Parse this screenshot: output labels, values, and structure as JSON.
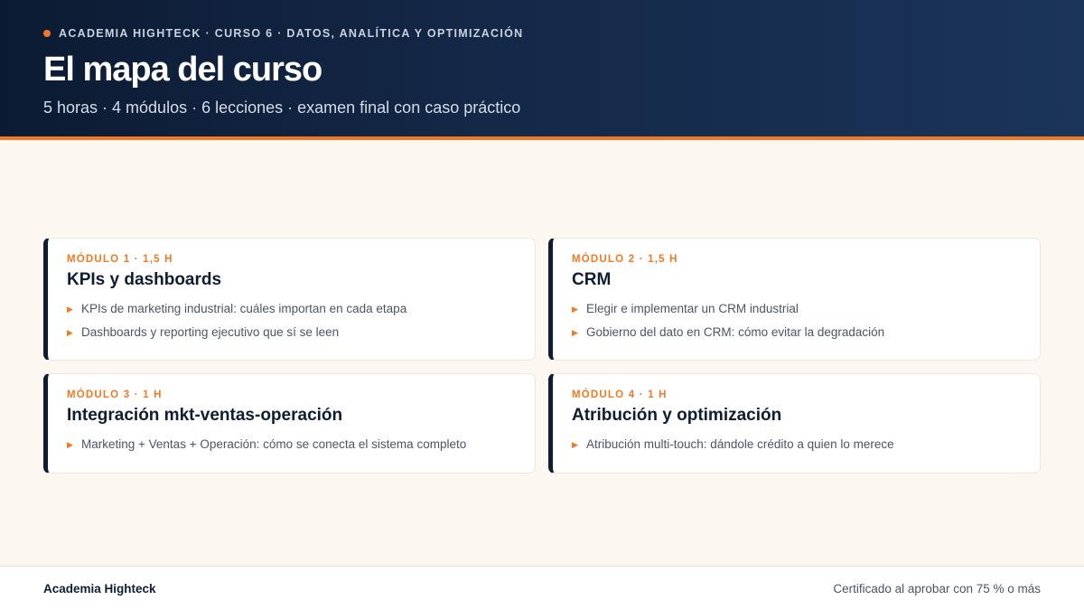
{
  "header": {
    "eyebrow": "ACADEMIA HIGHTECK · CURSO 6 · DATOS, ANALÍTICA Y OPTIMIZACIÓN",
    "title": "El mapa del curso",
    "subtitle": "5 horas · 4 módulos · 6 lecciones · examen final con caso práctico"
  },
  "modules": [
    {
      "meta": "MÓDULO 1 · 1,5 H",
      "title": "KPIs y dashboards",
      "lessons": [
        "KPIs de marketing industrial: cuáles importan en cada etapa",
        "Dashboards y reporting ejecutivo que sí se leen"
      ]
    },
    {
      "meta": "MÓDULO 2 · 1,5 H",
      "title": "CRM",
      "lessons": [
        "Elegir e implementar un CRM industrial",
        "Gobierno del dato en CRM: cómo evitar la degradación"
      ]
    },
    {
      "meta": "MÓDULO 3 · 1 H",
      "title": "Integración mkt-ventas-operación",
      "lessons": [
        "Marketing + Ventas + Operación: cómo se conecta el sistema completo"
      ]
    },
    {
      "meta": "MÓDULO 4 · 1 H",
      "title": "Atribución y optimización",
      "lessons": [
        "Atribución multi-touch: dándole crédito a quien lo merece"
      ]
    }
  ],
  "footer": {
    "brand": "Academia Highteck",
    "certificate": "Certificado al aprobar con 75 % o más"
  },
  "colors": {
    "accent": "#ef7a23",
    "navy": "#0f1d33"
  },
  "icons": {
    "eyebrow_marker": "orange-dot-icon",
    "lesson_bullet": "triangle-right-icon"
  }
}
